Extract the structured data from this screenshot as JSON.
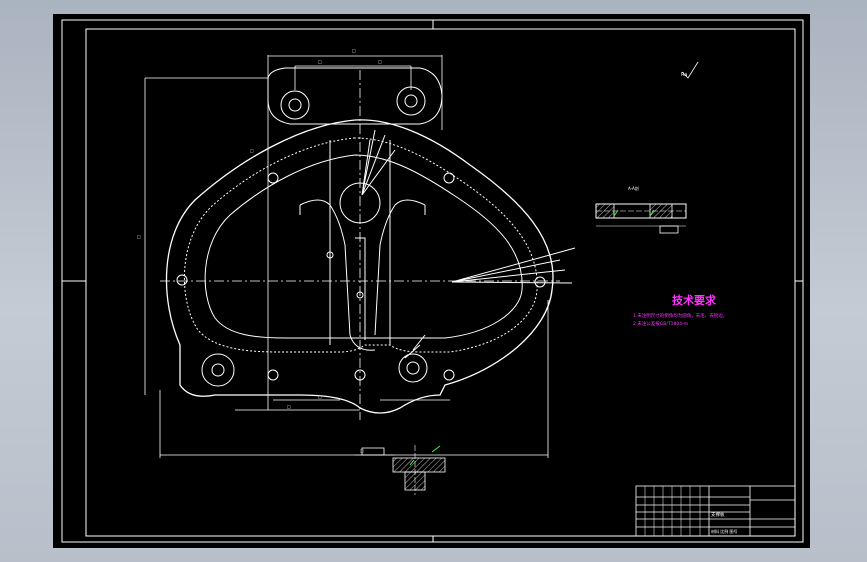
{
  "colors": {
    "background": "#000000",
    "lines": "#ffffff",
    "accent_text": "#ff33ff",
    "green_marks": "#33ff33",
    "viewport": "#b4bcc8"
  },
  "notes": {
    "title": "技术要求",
    "line1": "1.未注明尺寸的倒角均为圆角，去毛、去锐边。",
    "line2": "2.未注公差按GB/T1804-m"
  },
  "section": {
    "label": "A-A剖",
    "callout": "1.6"
  },
  "roughness": {
    "symbol": "Ra"
  },
  "titleblock": {
    "part_name": "支撑板",
    "row2": "材料  比例  图号"
  }
}
